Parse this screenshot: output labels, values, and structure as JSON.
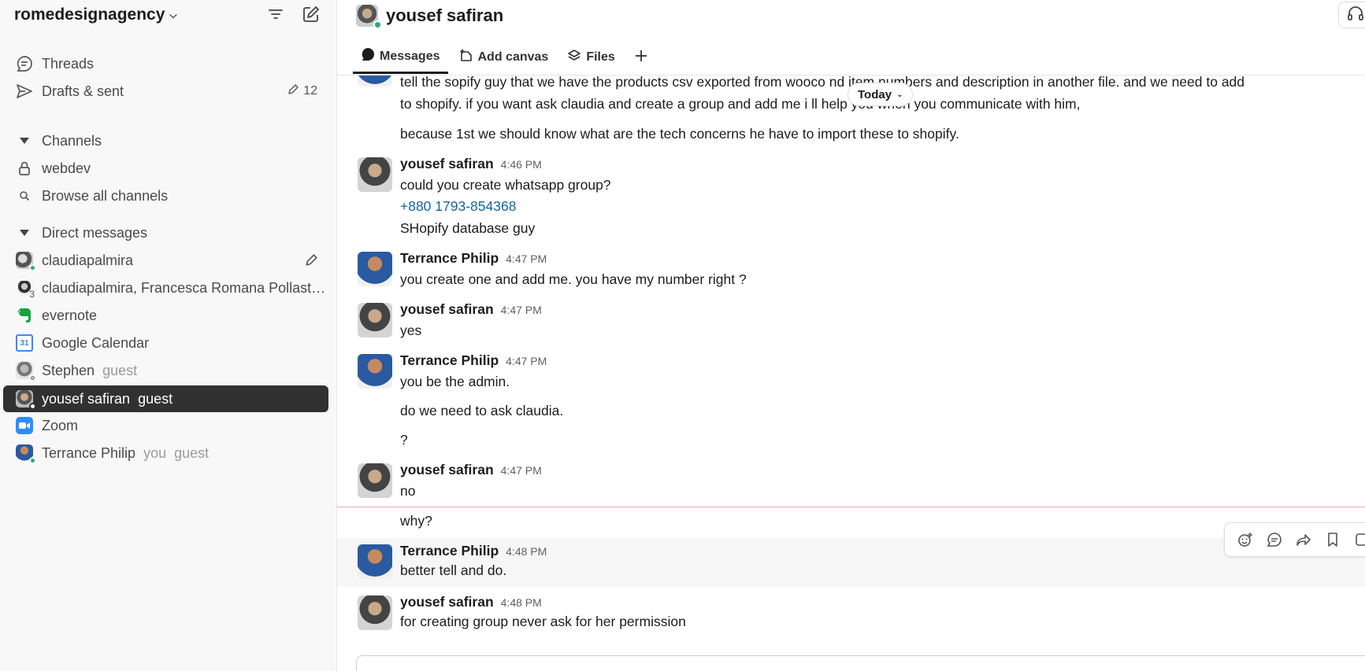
{
  "workspace": {
    "name": "romedesignagency"
  },
  "sidebar": {
    "threads_label": "Threads",
    "drafts_label": "Drafts & sent",
    "drafts_count": "12",
    "channels_section": "Channels",
    "channel_webdev": "webdev",
    "browse_channels": "Browse all channels",
    "dm_section": "Direct messages",
    "dms": [
      {
        "name": "claudiapalmira",
        "tag": ""
      },
      {
        "name": "claudiapalmira, Francesca Romana Pollast…",
        "tag": "",
        "count": "3"
      },
      {
        "name": "evernote",
        "tag": ""
      },
      {
        "name": "Google Calendar",
        "tag": "",
        "icon_text": "31"
      },
      {
        "name": "Stephen",
        "tag": "guest"
      },
      {
        "name": "yousef safiran",
        "tag": "guest"
      },
      {
        "name": "Zoom",
        "tag": ""
      },
      {
        "name": "Terrance Philip",
        "tag": "you",
        "tag2": "guest"
      }
    ]
  },
  "channel": {
    "title": "yousef safiran",
    "tabs": [
      {
        "label": "Messages"
      },
      {
        "label": "Add canvas"
      },
      {
        "label": "Files"
      }
    ],
    "today_label": "Today"
  },
  "messages": {
    "top_line1": "tell the sopify guy that we have the products csv exported from wooco                                  nd item numbers and description in another file. and we need to add",
    "top_line2": "to shopify. if you want ask claudia and create a group and add me i ll help you when you communicate with him,",
    "top_line3": "because 1st we should know what are the tech concerns he have to import these to shopify.",
    "m1": {
      "name": "yousef safiran",
      "time": "4:46 PM",
      "line1": "could you create whatsapp group?",
      "line2": "+880 1793-854368",
      "line3": "SHopify database guy"
    },
    "m2": {
      "name": "Terrance Philip",
      "time": "4:47 PM",
      "line1": "you create one and add me. you have my number right ?"
    },
    "m3": {
      "name": "yousef safiran",
      "time": "4:47 PM",
      "line1": "yes"
    },
    "m4": {
      "name": "Terrance Philip",
      "time": "4:47 PM",
      "line1": "you be the admin.",
      "line2": "do we need to ask claudia.",
      "line3": "?"
    },
    "m5": {
      "name": "yousef safiran",
      "time": "4:47 PM",
      "line1": "no",
      "line2": "why?"
    },
    "m6": {
      "name": "Terrance Philip",
      "time": "4:48 PM",
      "line1": "better tell and do."
    },
    "m7": {
      "name": "yousef safiran",
      "time": "4:48 PM",
      "line1": "for creating group never ask for her permission"
    }
  },
  "colors": {
    "sidebar_bg": "#f8f8f8",
    "active_item_bg": "#313131",
    "link": "#1264a3",
    "new_divider": "#e8a8b4",
    "online": "#2bac76"
  }
}
